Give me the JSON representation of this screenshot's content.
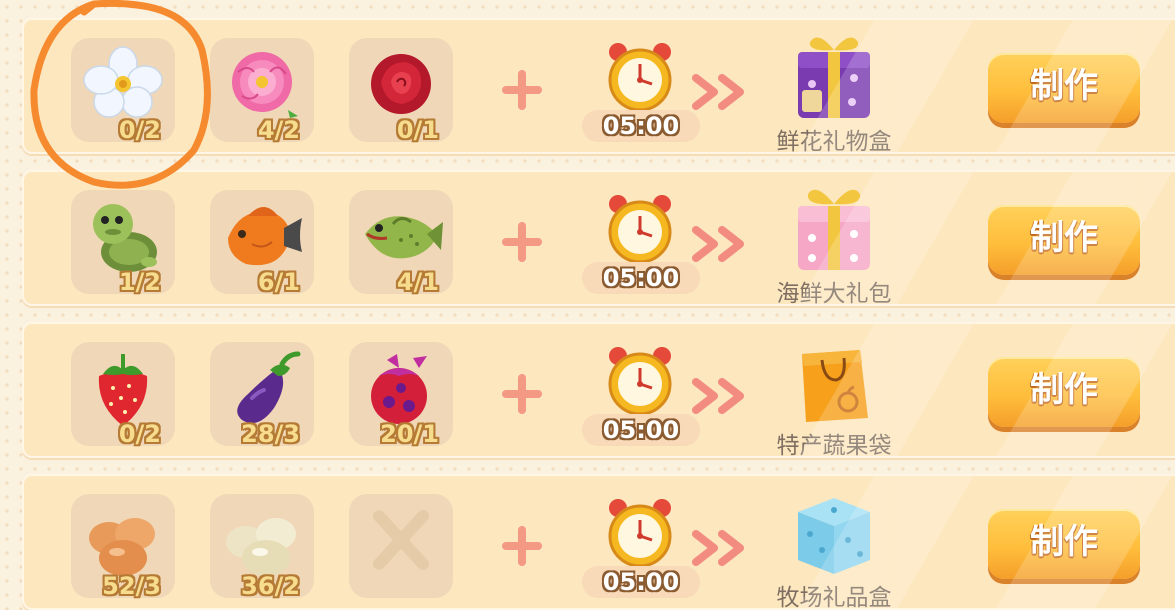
{
  "recipes": [
    {
      "ingredients": [
        {
          "icon": "white-flower-icon",
          "count": "0/2"
        },
        {
          "icon": "pink-peony-icon",
          "count": "4/2"
        },
        {
          "icon": "red-rose-icon",
          "count": "0/1"
        }
      ],
      "time": "05:00",
      "product": {
        "icon": "purple-gift-box-icon",
        "name": "鲜花礼物盒"
      },
      "button_label": "制作"
    },
    {
      "ingredients": [
        {
          "icon": "turtle-icon",
          "count": "1/2"
        },
        {
          "icon": "orange-fish-icon",
          "count": "6/1"
        },
        {
          "icon": "green-bass-fish-icon",
          "count": "4/1"
        }
      ],
      "time": "05:00",
      "product": {
        "icon": "pink-gift-box-icon",
        "name": "海鲜大礼包"
      },
      "button_label": "制作"
    },
    {
      "ingredients": [
        {
          "icon": "strawberry-icon",
          "count": "0/2"
        },
        {
          "icon": "eggplant-icon",
          "count": "28/3"
        },
        {
          "icon": "dragon-fruit-icon",
          "count": "20/1"
        }
      ],
      "time": "05:00",
      "product": {
        "icon": "orange-shopping-bag-icon",
        "name": "特产蔬果袋"
      },
      "button_label": "制作"
    },
    {
      "ingredients": [
        {
          "icon": "brown-eggs-icon",
          "count": "52/3"
        },
        {
          "icon": "white-eggs-icon",
          "count": "36/2"
        },
        {
          "icon": "empty-slot-x-icon",
          "count": ""
        }
      ],
      "time": "05:00",
      "product": {
        "icon": "blue-gift-box-icon",
        "name": "牧场礼品盒"
      },
      "button_label": "制作"
    }
  ],
  "colors": {
    "annotation": "#f58a2e",
    "button": "#ffbe3c",
    "row": "#fde7bf"
  }
}
